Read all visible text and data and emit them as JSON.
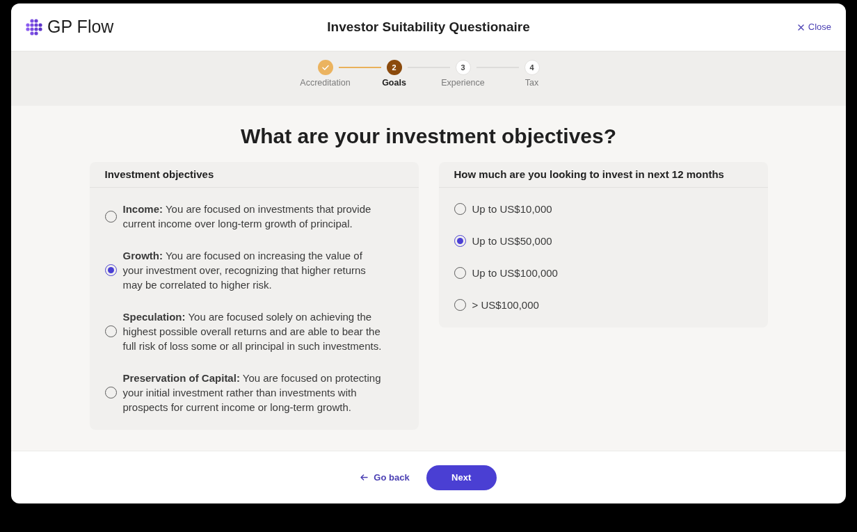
{
  "window": {
    "title": "Investor Suitability Questionaire"
  },
  "brand": {
    "name": "GP Flow"
  },
  "close_button": {
    "label": "Close"
  },
  "stepper": [
    {
      "label": "Accreditation",
      "completed": true,
      "selected": false
    },
    {
      "number": "2",
      "label": "Goals",
      "completed": false,
      "selected": true
    },
    {
      "number": "3",
      "label": "Experience",
      "completed": false,
      "selected": false
    },
    {
      "number": "4",
      "label": "Tax",
      "completed": false,
      "selected": false
    }
  ],
  "question": {
    "title": "What are your investment objectives?"
  },
  "panels": [
    {
      "title": "Investment objectives",
      "options": [
        {
          "text": "**Income:** You are focused on investments that provide current income over long-term growth of principal.",
          "selected": false
        },
        {
          "text": "**Growth:** You are focused on increasing the value of your investment over, recognizing that higher returns may be correlated to higher risk.",
          "selected": true
        },
        {
          "text": "**Speculation:** You are focused solely on achieving the highest possible overall returns and are able to bear the full risk of loss some or all principal in such investments.",
          "selected": false
        },
        {
          "text": "**Preservation of Capital:** You are focused on protecting your initial investment rather than investments with prospects for current income or long-term growth.",
          "selected": false
        }
      ]
    },
    {
      "title": "How much are you looking to invest in next 12 months",
      "options": [
        {
          "text": "Up to US$10,000",
          "selected": false
        },
        {
          "text": "Up to US$50,000",
          "selected": true
        },
        {
          "text": "Up to US$100,000",
          "selected": false
        },
        {
          "text": "> US$100,000",
          "selected": false
        }
      ]
    }
  ],
  "footer": {
    "back_button": {
      "label": "Go back"
    },
    "next_button": {
      "label": "Next"
    }
  }
}
